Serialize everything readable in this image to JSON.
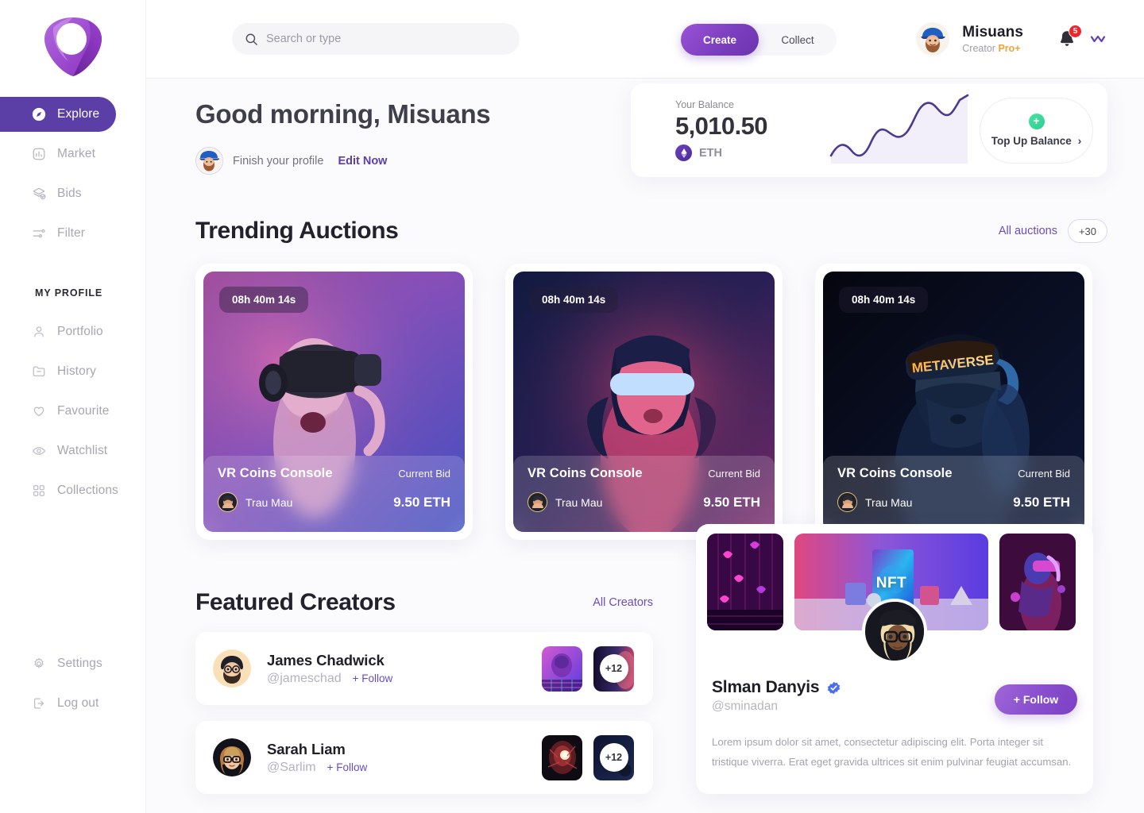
{
  "brand": {
    "logo_name": "diamond-logo",
    "accent": "#5b3fa6",
    "accent2": "#8a4fce"
  },
  "sidebar": {
    "nav": [
      {
        "label": "Explore",
        "icon": "compass-icon",
        "active": true
      },
      {
        "label": "Market",
        "icon": "chart-box-icon",
        "active": false
      },
      {
        "label": "Bids",
        "icon": "layers-check-icon",
        "active": false
      },
      {
        "label": "Filter",
        "icon": "sliders-icon",
        "active": false
      }
    ],
    "section_label": "MY PROFILE",
    "profile_nav": [
      {
        "label": "Portfolio",
        "icon": "user-icon"
      },
      {
        "label": "History",
        "icon": "folder-minus-icon"
      },
      {
        "label": "Favourite",
        "icon": "heart-icon"
      },
      {
        "label": "Watchlist",
        "icon": "eye-icon"
      },
      {
        "label": "Collections",
        "icon": "grid-icon"
      }
    ],
    "bottom_nav": [
      {
        "label": "Settings",
        "icon": "gear-icon"
      },
      {
        "label": "Log out",
        "icon": "logout-icon"
      }
    ]
  },
  "header": {
    "search": {
      "placeholder": "Search or type",
      "value": "",
      "icon": "search-icon"
    },
    "segmented": {
      "create": "Create",
      "collect": "Collect",
      "selected": "Create"
    },
    "user": {
      "name": "Misuans",
      "role_prefix": "Creator ",
      "role_badge": "Pro+",
      "avatar": "user-avatar"
    },
    "notifications": {
      "count": "5",
      "icon": "bell-icon"
    },
    "wallet_icon": "wallet-icon"
  },
  "greeting": {
    "title": "Good morning, Misuans",
    "finish_text": "Finish your profile",
    "edit_link": "Edit Now"
  },
  "balance": {
    "label": "Your Balance",
    "amount": "5,010.50",
    "currency": "ETH",
    "currency_icon": "ethereum-icon",
    "topup_label": "Top Up Balance",
    "topup_plus": "+",
    "chevron": "›"
  },
  "chart_data": {
    "type": "area",
    "title": "Your Balance",
    "x": [
      0,
      1,
      2,
      3,
      4,
      5,
      6,
      7,
      8,
      9,
      10
    ],
    "values": [
      18,
      34,
      16,
      28,
      54,
      50,
      46,
      80,
      92,
      74,
      96
    ],
    "ylabel": "",
    "xlabel": "",
    "grid": false,
    "legend": "none",
    "line_color": "#4b3a8f",
    "fill_color": "#efeaf8"
  },
  "trending": {
    "heading": "Trending Auctions",
    "all_link": "All auctions",
    "count_pill": "+30",
    "cards": [
      {
        "timer": "08h 40m 14s",
        "title": "VR Coins Console",
        "bid_label": "Current Bid",
        "owner": "Trau Mau",
        "price": "9.50 ETH",
        "theme": "pink"
      },
      {
        "timer": "08h 40m 14s",
        "title": "VR Coins Console",
        "bid_label": "Current Bid",
        "owner": "Trau Mau",
        "price": "9.50 ETH",
        "theme": "blue"
      },
      {
        "timer": "08h 40m 14s",
        "title": "VR Coins Console",
        "bid_label": "Current Bid",
        "owner": "Trau Mau",
        "price": "9.50 ETH",
        "theme": "dark",
        "artwork_text": "METAVERSE"
      }
    ]
  },
  "featured": {
    "heading": "Featured Creators",
    "all_link": "All Creators",
    "creators": [
      {
        "name": "James Chadwick",
        "handle": "@jameschad",
        "follow": "+ Follow",
        "more": "+12"
      },
      {
        "name": "Sarah Liam",
        "handle": "@Sarlim",
        "follow": "+ Follow",
        "more": "+12"
      }
    ]
  },
  "profile_panel": {
    "nft_label": "NFT",
    "name": "Slman Danyis",
    "verified_icon": "verified-badge-icon",
    "handle": "@sminadan",
    "follow_button": "+ Follow",
    "bio": "Lorem ipsum dolor sit amet, consectetur adipiscing elit. Porta integer sit tristique viverra. Erat eget gravida ultrices sit enim pulvinar feugiat accumsan."
  }
}
